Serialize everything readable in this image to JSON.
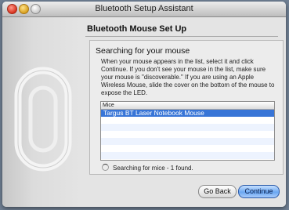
{
  "window": {
    "title": "Bluetooth Setup Assistant"
  },
  "section": {
    "title": "Bluetooth Mouse Set Up"
  },
  "panel": {
    "heading": "Searching for your mouse",
    "instructions": "When your mouse appears in the list, select it and click Continue. If you don't see your mouse in the list, make sure your mouse is \"discoverable.\" If you are using an Apple Wireless Mouse, slide the cover on the bottom of the mouse to expose the LED."
  },
  "list": {
    "header": "Mice",
    "items": [
      "Targus BT Laser Notebook Mouse"
    ],
    "selected_index": 0
  },
  "status": {
    "text": "Searching for mice - 1 found."
  },
  "buttons": {
    "back": "Go Back",
    "continue": "Continue"
  },
  "colors": {
    "selection": "#3875d7",
    "default_button": "#6aa7f2"
  }
}
